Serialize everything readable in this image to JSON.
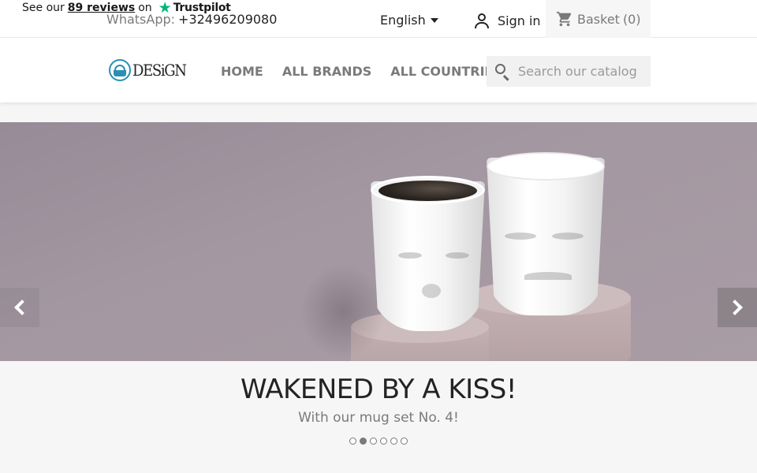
{
  "trustpilot": {
    "prefix": "See our",
    "count": "89 reviews",
    "suffix": "on",
    "brand": "Trustpilot",
    "brand_color": "#00b67a"
  },
  "topbar": {
    "whatsapp_label": "WhatsApp:",
    "whatsapp_number": "+32496209080",
    "language": "English",
    "signin": "Sign in",
    "basket_label": "Basket",
    "basket_count": "(0)"
  },
  "header": {
    "logo_text": "DESiGN",
    "nav": [
      "HOME",
      "ALL BRANDS",
      "ALL COUNTRIES"
    ],
    "search_placeholder": "Search our catalog"
  },
  "slider": {
    "title": "WAKENED BY A KISS!",
    "subtitle": "With our mug set No. 4!",
    "slides_total": 6,
    "active_slide": 2
  },
  "icons": {
    "user": "user-icon",
    "cart": "cart-icon",
    "search": "search-icon",
    "prev": "chevron-left-icon",
    "next": "chevron-right-icon"
  },
  "colors": {
    "accent": "#2a8fb5",
    "slider_bg": "#a397a1",
    "text": "#232323",
    "muted": "#7a7a7a"
  }
}
